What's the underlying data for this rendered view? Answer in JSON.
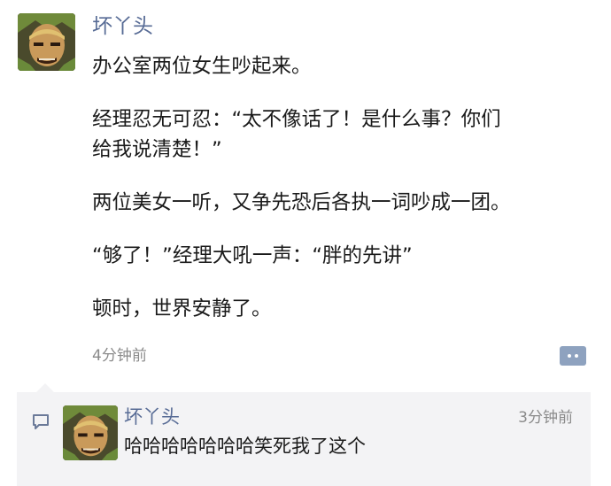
{
  "post": {
    "author": "坏丫头",
    "avatar_icon": "one-piece-character-avatar",
    "paragraphs": [
      "办公室两位女生吵起来。",
      "经理忍无可忍：“太不像话了！是什么事？你们",
      "给我说清楚！”",
      "两位美女一听，又争先恐后各执一词吵成一团。",
      "“够了！”经理大吼一声：“胖的先讲”",
      "顿时，世界安静了。"
    ],
    "time": "4分钟前",
    "action_icon": "more-dots-icon"
  },
  "comments": [
    {
      "author": "坏丫头",
      "time": "3分钟前",
      "text": "哈哈哈哈哈哈哈笑死我了这个",
      "icon": "comment-bubble-icon"
    }
  ],
  "colors": {
    "name_link": "#576b95",
    "meta_gray": "#8a8a8a",
    "panel_bg": "#f3f3f5",
    "action_button": "#8ea2bf"
  }
}
